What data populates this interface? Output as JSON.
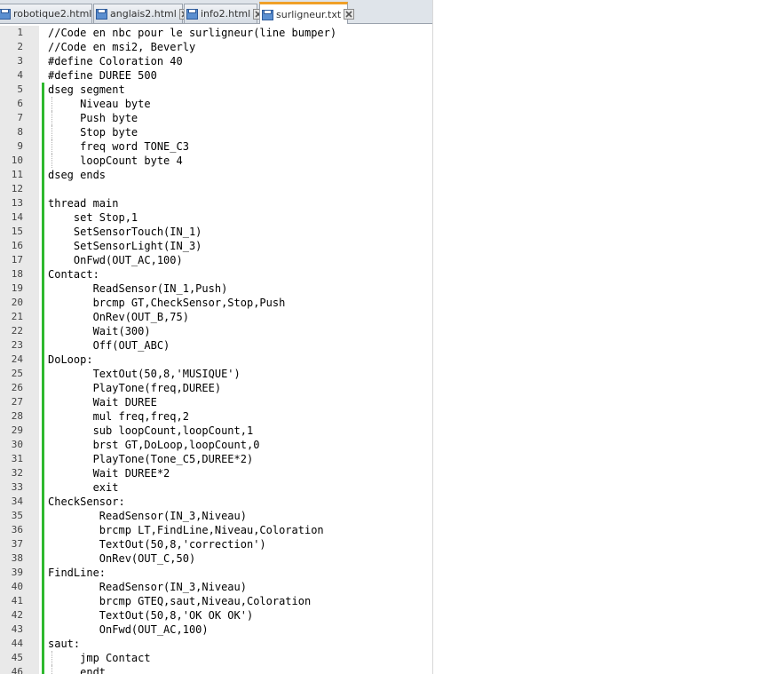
{
  "tabs": [
    {
      "label": "robotique2.html",
      "active": false
    },
    {
      "label": "anglais2.html",
      "active": false
    },
    {
      "label": "info2.html",
      "active": false
    },
    {
      "label": "surligneur.txt",
      "active": true
    }
  ],
  "lines": [
    {
      "n": "1",
      "text": "//Code en nbc pour le surligneur(line bumper)"
    },
    {
      "n": "2",
      "text": "//Code en msi2, Beverly"
    },
    {
      "n": "3",
      "text": "#define Coloration 40"
    },
    {
      "n": "4",
      "text": "#define DUREE 500"
    },
    {
      "n": "5",
      "text": "dseg segment"
    },
    {
      "n": "6",
      "text": "     Niveau byte"
    },
    {
      "n": "7",
      "text": "     Push byte"
    },
    {
      "n": "8",
      "text": "     Stop byte"
    },
    {
      "n": "9",
      "text": "     freq word TONE_C3"
    },
    {
      "n": "10",
      "text": "     loopCount byte 4"
    },
    {
      "n": "11",
      "text": "dseg ends"
    },
    {
      "n": "12",
      "text": ""
    },
    {
      "n": "13",
      "text": "thread main"
    },
    {
      "n": "14",
      "text": "    set Stop,1"
    },
    {
      "n": "15",
      "text": "    SetSensorTouch(IN_1)"
    },
    {
      "n": "16",
      "text": "    SetSensorLight(IN_3)"
    },
    {
      "n": "17",
      "text": "    OnFwd(OUT_AC,100)"
    },
    {
      "n": "18",
      "text": "Contact:"
    },
    {
      "n": "19",
      "text": "       ReadSensor(IN_1,Push)"
    },
    {
      "n": "20",
      "text": "       brcmp GT,CheckSensor,Stop,Push"
    },
    {
      "n": "21",
      "text": "       OnRev(OUT_B,75)"
    },
    {
      "n": "22",
      "text": "       Wait(300)"
    },
    {
      "n": "23",
      "text": "       Off(OUT_ABC)"
    },
    {
      "n": "24",
      "text": "DoLoop:"
    },
    {
      "n": "25",
      "text": "       TextOut(50,8,'MUSIQUE')"
    },
    {
      "n": "26",
      "text": "       PlayTone(freq,DUREE)"
    },
    {
      "n": "27",
      "text": "       Wait DUREE"
    },
    {
      "n": "28",
      "text": "       mul freq,freq,2"
    },
    {
      "n": "29",
      "text": "       sub loopCount,loopCount,1"
    },
    {
      "n": "30",
      "text": "       brst GT,DoLoop,loopCount,0"
    },
    {
      "n": "31",
      "text": "       PlayTone(Tone_C5,DUREE*2)"
    },
    {
      "n": "32",
      "text": "       Wait DUREE*2"
    },
    {
      "n": "33",
      "text": "       exit"
    },
    {
      "n": "34",
      "text": "CheckSensor:"
    },
    {
      "n": "35",
      "text": "        ReadSensor(IN_3,Niveau)"
    },
    {
      "n": "36",
      "text": "        brcmp LT,FindLine,Niveau,Coloration"
    },
    {
      "n": "37",
      "text": "        TextOut(50,8,'correction')"
    },
    {
      "n": "38",
      "text": "        OnRev(OUT_C,50)"
    },
    {
      "n": "39",
      "text": "FindLine:"
    },
    {
      "n": "40",
      "text": "        ReadSensor(IN_3,Niveau)"
    },
    {
      "n": "41",
      "text": "        brcmp GTEQ,saut,Niveau,Coloration"
    },
    {
      "n": "42",
      "text": "        TextOut(50,8,'OK OK OK')"
    },
    {
      "n": "43",
      "text": "        OnFwd(OUT_AC,100)"
    },
    {
      "n": "44",
      "text": "saut:"
    },
    {
      "n": "45",
      "text": "     jmp Contact"
    },
    {
      "n": "46",
      "text": "     endt"
    }
  ]
}
